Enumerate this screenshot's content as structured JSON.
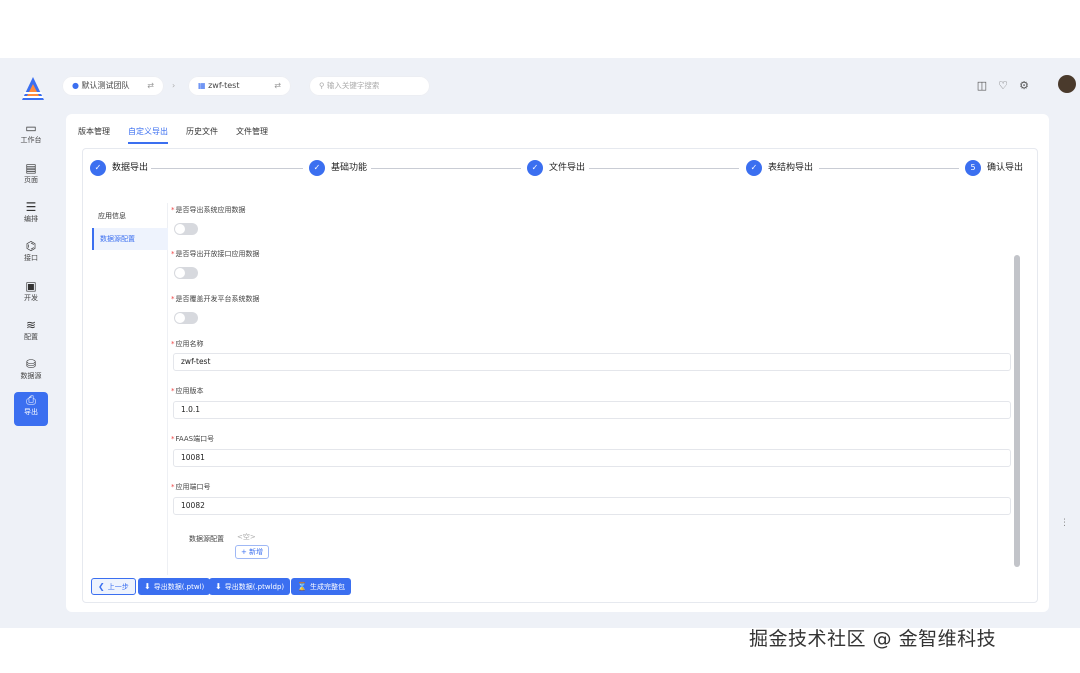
{
  "nav": {
    "items": [
      {
        "icon": "monitor-icon",
        "glyph": "▭",
        "label": "工作台"
      },
      {
        "icon": "page-icon",
        "glyph": "▤",
        "label": "页面"
      },
      {
        "icon": "list-icon",
        "glyph": "☰",
        "label": "编排"
      },
      {
        "icon": "api-icon",
        "glyph": "⌬",
        "label": "接口"
      },
      {
        "icon": "code-icon",
        "glyph": "▣",
        "label": "开发"
      },
      {
        "icon": "config-icon",
        "glyph": "≋",
        "label": "配置"
      },
      {
        "icon": "database-icon",
        "glyph": "⛁",
        "label": "数据源"
      },
      {
        "icon": "export-icon",
        "glyph": "⎙",
        "label": "导出"
      }
    ]
  },
  "topbar": {
    "team": "默认测试团队",
    "project": "zwf-test",
    "swap_glyph": "⇄",
    "separator": "›",
    "search_placeholder": "输入关键字搜索"
  },
  "tabs": [
    "版本管理",
    "自定义导出",
    "历史文件",
    "文件管理"
  ],
  "active_tab": "自定义导出",
  "steps": [
    {
      "mark": "✓",
      "label": "数据导出"
    },
    {
      "mark": "✓",
      "label": "基础功能"
    },
    {
      "mark": "✓",
      "label": "文件导出"
    },
    {
      "mark": "✓",
      "label": "表结构导出"
    },
    {
      "mark": "5",
      "label": "确认导出"
    }
  ],
  "subnav": [
    "应用信息",
    "数据源配置"
  ],
  "form": {
    "switch1_label": "是否导出系统应用数据",
    "switch2_label": "是否导出开放接口应用数据",
    "switch3_label": "是否覆盖开发平台系统数据",
    "app_name_label": "应用名称",
    "app_name_value": "zwf-test",
    "app_version_label": "应用版本",
    "app_version_value": "1.0.1",
    "faas_port_label": "FAAS端口号",
    "faas_port_value": "10081",
    "app_port_label": "应用端口号",
    "app_port_value": "10082",
    "datasource_label": "数据源配置",
    "datasource_empty": "<空>",
    "add_button": "+ 新增"
  },
  "buttons": {
    "prev": "上一步",
    "export_ptwl": "导出数据(.ptwl)",
    "export_ptwldp": "导出数据(.ptwldp)",
    "generate": "生成完整包"
  },
  "watermark": "掘金技术社区 @ 金智维科技"
}
